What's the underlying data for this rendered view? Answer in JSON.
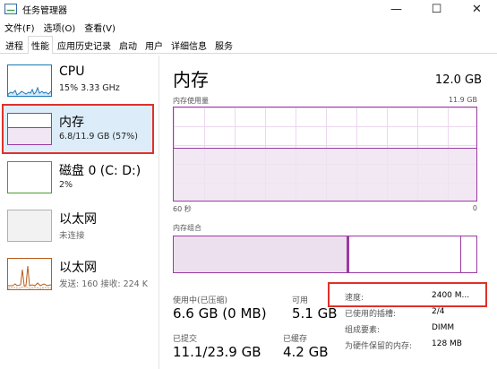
{
  "window": {
    "title": "任务管理器",
    "controls": {
      "minimize": "—",
      "maximize": "☐",
      "close": "✕"
    }
  },
  "menu": [
    "文件(F)",
    "选项(O)",
    "查看(V)"
  ],
  "tabs": [
    {
      "label": "进程",
      "active": false
    },
    {
      "label": "性能",
      "active": true
    },
    {
      "label": "应用历史记录",
      "active": false
    },
    {
      "label": "启动",
      "active": false
    },
    {
      "label": "用户",
      "active": false
    },
    {
      "label": "详细信息",
      "active": false
    },
    {
      "label": "服务",
      "active": false
    }
  ],
  "sidebar": {
    "items": [
      {
        "title": "CPU",
        "sub": "15% 3.33 GHz",
        "color": "#1a7ab8"
      },
      {
        "title": "内存",
        "sub": "6.8/11.9 GB (57%)",
        "color": "#9a3ba3",
        "selected": true
      },
      {
        "title": "磁盘 0 (C: D:)",
        "sub": "2%",
        "color": "#4a9b2e"
      },
      {
        "title": "以太网",
        "sub": "未连接",
        "color": "#a0a0a0"
      },
      {
        "title": "以太网",
        "sub": "发送: 160 接收: 224 K",
        "color": "#b85c1a"
      }
    ]
  },
  "main": {
    "title": "内存",
    "total": "12.0 GB",
    "usage_label": "内存使用量",
    "usage_max": "11.9 GB",
    "usage_fraction": 0.57,
    "time_left": "60 秒",
    "time_right": "0",
    "composition_label": "内存组合",
    "stats": {
      "in_use_label": "使用中(已压缩)",
      "in_use_value": "6.6 GB (0 MB)",
      "available_label": "可用",
      "available_value": "5.1 GB",
      "committed_label": "已提交",
      "committed_value": "11.1/23.9 GB",
      "cached_label": "已缓存",
      "cached_value": "4.2 GB"
    },
    "details": [
      {
        "label": "速度:",
        "value": "2400 M..."
      },
      {
        "label": "已使用的插槽:",
        "value": "2/4"
      },
      {
        "label": "组成要素:",
        "value": "DIMM"
      },
      {
        "label": "为硬件保留的内存:",
        "value": "128 MB"
      }
    ]
  },
  "colors": {
    "memory": "#9a3ba3",
    "highlight": "#e0302b",
    "selection_bg": "#dcecf8"
  }
}
